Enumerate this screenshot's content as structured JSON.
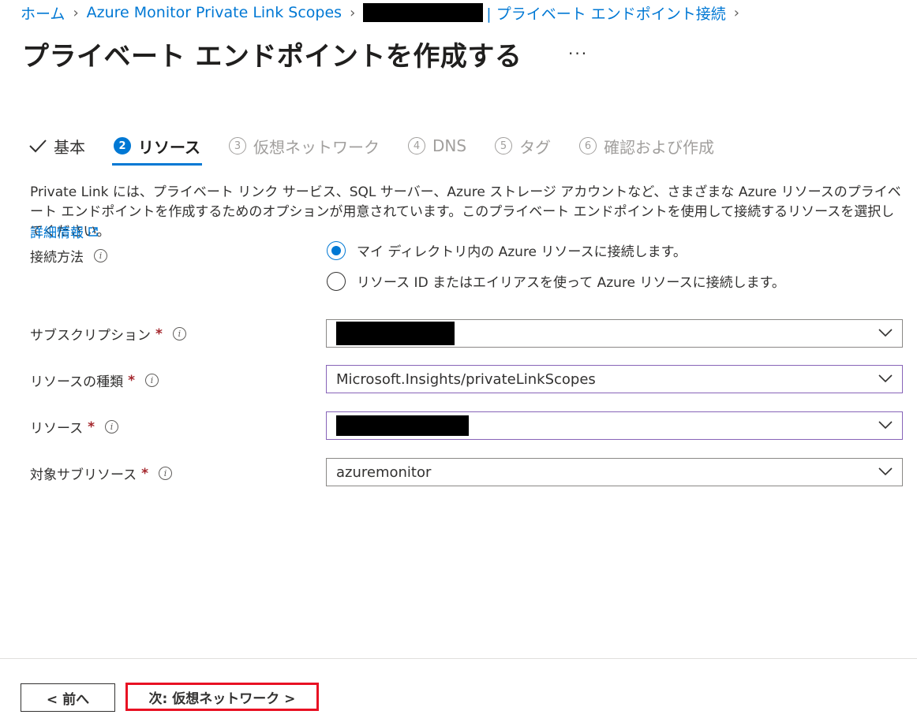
{
  "breadcrumb": {
    "home": "ホーム",
    "scopes": "Azure Monitor Private Link Scopes",
    "current": "| プライベート エンドポイント接続"
  },
  "page": {
    "title": "プライベート エンドポイントを作成する",
    "more": "..."
  },
  "steps": [
    {
      "label": "基本",
      "state": "done"
    },
    {
      "num": "2",
      "label": "リソース",
      "state": "active"
    },
    {
      "num": "3",
      "label": "仮想ネットワーク",
      "state": "inactive"
    },
    {
      "num": "4",
      "label": "DNS",
      "state": "inactive"
    },
    {
      "num": "5",
      "label": "タグ",
      "state": "inactive"
    },
    {
      "num": "6",
      "label": "確認および作成",
      "state": "inactive"
    }
  ],
  "description": "Private Link には、プライベート リンク サービス、SQL サーバー、Azure ストレージ アカウントなど、さまざまな Azure リソースのプライベート エンドポイントを作成するためのオプションが用意されています。このプライベート エンドポイントを使用して接続するリソースを選択してください。",
  "learn_more": "詳細情報",
  "form": {
    "connection_method": {
      "label": "接続方法",
      "options": [
        {
          "label": "マイ ディレクトリ内の Azure リソースに接続します。",
          "selected": true
        },
        {
          "label": "リソース ID またはエイリアスを使って Azure リソースに接続します。",
          "selected": false
        }
      ]
    },
    "subscription": {
      "label": "サブスクリプション",
      "required": "*",
      "value": ""
    },
    "resource_type": {
      "label": "リソースの種類",
      "required": "*",
      "value": "Microsoft.Insights/privateLinkScopes"
    },
    "resource": {
      "label": "リソース",
      "required": "*",
      "value": ""
    },
    "sub_resource": {
      "label": "対象サブリソース",
      "required": "*",
      "value": "azuremonitor"
    }
  },
  "footer": {
    "prev": "< 前へ",
    "next": "次: 仮想ネットワーク >"
  },
  "colors": {
    "accent": "#0078d4",
    "required": "#a4262c",
    "highlight": "#e81123"
  }
}
